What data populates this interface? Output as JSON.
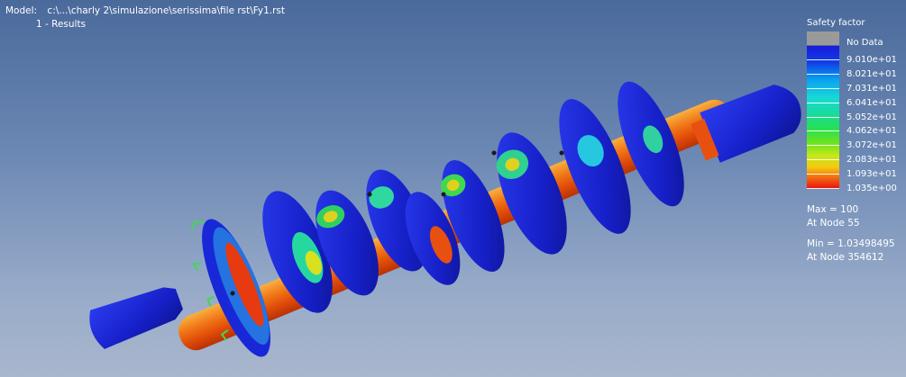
{
  "model": {
    "label": "Model:",
    "path": "c:\\...\\charly 2\\simulazione\\serissima\\file rst\\Fy1.rst",
    "results_label": "1 - Results"
  },
  "legend": {
    "title": "Safety factor",
    "no_data_label": "No Data",
    "no_data_color": "#9a9a9a",
    "ticks": [
      "9.010e+01",
      "8.021e+01",
      "7.031e+01",
      "6.041e+01",
      "5.052e+01",
      "4.062e+01",
      "3.072e+01",
      "2.083e+01",
      "1.093e+01",
      "1.035e+00"
    ],
    "colors": [
      "#1a1ad8",
      "#1040e8",
      "#0aa4ef",
      "#18d8d8",
      "#18dc98",
      "#26e050",
      "#6ee41e",
      "#c8e81a",
      "#f4c810",
      "#f46a10",
      "#e61010"
    ]
  },
  "stats": {
    "max_line": "Max = 100",
    "max_node": "At Node 55",
    "min_line": "Min = 1.03498495",
    "min_node": "At Node 354612"
  }
}
